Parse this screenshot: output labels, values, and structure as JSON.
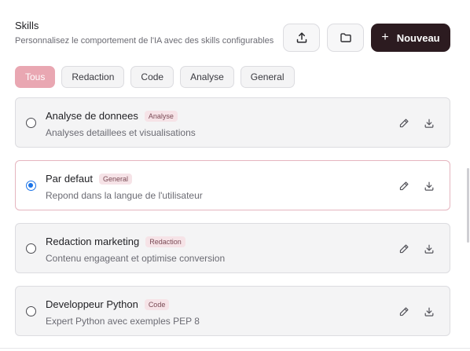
{
  "header": {
    "title": "Skills",
    "subtitle": "Personnalisez le comportement de l'IA avec des skills configurables"
  },
  "toolbar": {
    "upload_icon": "upload-icon",
    "folder_icon": "folder-icon",
    "new_label": "Nouveau",
    "new_icon": "plus-icon",
    "accent": "#2c1b20"
  },
  "filters": [
    {
      "label": "Tous",
      "active": true
    },
    {
      "label": "Redaction",
      "active": false
    },
    {
      "label": "Code",
      "active": false
    },
    {
      "label": "Analyse",
      "active": false
    },
    {
      "label": "General",
      "active": false
    }
  ],
  "skills": [
    {
      "name": "Analyse de donnees",
      "tag": "Analyse",
      "description": "Analyses detaillees et visualisations",
      "selected": false
    },
    {
      "name": "Par defaut",
      "tag": "General",
      "description": "Repond dans la langue de l'utilisateur",
      "selected": true
    },
    {
      "name": "Redaction marketing",
      "tag": "Redaction",
      "description": "Contenu engageant et optimise conversion",
      "selected": false
    },
    {
      "name": "Developpeur Python",
      "tag": "Code",
      "description": "Expert Python avec exemples PEP 8",
      "selected": false
    }
  ],
  "colors": {
    "active_chip": "#e9a7b2",
    "radio_checked": "#1a73e8",
    "selected_border": "#e5b5bf"
  }
}
